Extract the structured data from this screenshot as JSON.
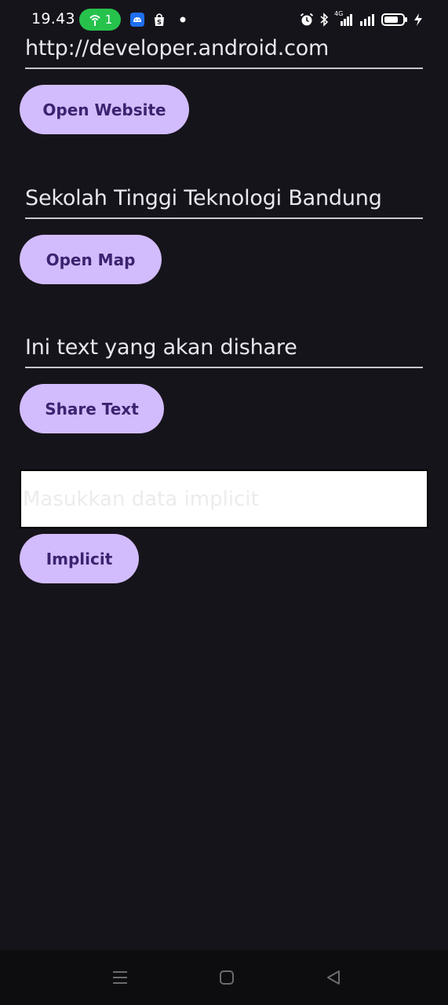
{
  "status_bar": {
    "time": "19.43",
    "hotspot_count": "1",
    "hotspot_color": "#27c24c",
    "network_label": "4G",
    "icons": [
      "hotspot-icon",
      "android-icon",
      "shopping-bag-icon",
      "dot-icon",
      "alarm-icon",
      "bluetooth-icon",
      "signal-icon",
      "battery-icon",
      "charging-icon"
    ]
  },
  "website": {
    "url_value": "http://developer.android.com",
    "button_label": "Open Website"
  },
  "map": {
    "location_value": "Sekolah Tinggi Teknologi Bandung",
    "button_label": "Open Map"
  },
  "share": {
    "text_value": "Ini text yang akan dishare",
    "button_label": "Share Text"
  },
  "implicit": {
    "placeholder": "Masukkan data implicit",
    "button_label": "Implicit"
  },
  "nav_bar": {
    "icons": [
      "menu-icon",
      "home-icon",
      "back-icon"
    ]
  },
  "colors": {
    "background": "#16141b",
    "button_fill": "#d2bcfd",
    "button_text": "#3a2470"
  }
}
